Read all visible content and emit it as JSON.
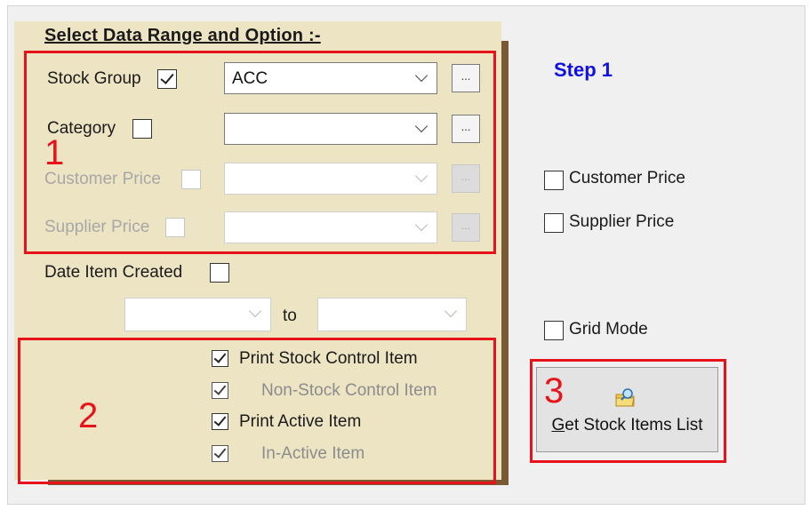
{
  "section_title": "Select Data Range and Option :-",
  "filters": {
    "stock_group": {
      "label": "Stock Group",
      "checked": true,
      "value": "ACC",
      "browse": "..."
    },
    "category": {
      "label": "Category",
      "checked": false,
      "value": "",
      "browse": "..."
    },
    "customer_price": {
      "label": "Customer Price",
      "checked": false,
      "enabled": false,
      "value": "",
      "browse": "..."
    },
    "supplier_price": {
      "label": "Supplier Price",
      "checked": false,
      "enabled": false,
      "value": "",
      "browse": "..."
    }
  },
  "date_item_created": {
    "label": "Date Item Created",
    "checked": false,
    "from": "",
    "to_label": "to",
    "to": ""
  },
  "print_options": {
    "print_stock_control_item": {
      "label": "Print Stock Control Item",
      "checked": true
    },
    "non_stock_control_item": {
      "label": "Non-Stock Control Item",
      "checked": true,
      "enabled": false
    },
    "print_active_item": {
      "label": "Print Active Item",
      "checked": true
    },
    "in_active_item": {
      "label": "In-Active Item",
      "checked": true,
      "enabled": false
    }
  },
  "right_panel": {
    "step": "Step 1",
    "customer_price": {
      "label": "Customer Price",
      "checked": false
    },
    "supplier_price": {
      "label": "Supplier Price",
      "checked": false
    },
    "grid_mode": {
      "label": "Grid Mode",
      "checked": false
    },
    "get_button": {
      "label_first": "G",
      "label_rest": "et Stock Items List",
      "icon": "folder-search-icon"
    }
  },
  "annotations": [
    "1",
    "2",
    "3"
  ],
  "colors": {
    "annotation": "#e8121a",
    "step": "#1010e0",
    "panel": "#ede4c4",
    "panel_shadow": "#7a5a33"
  }
}
